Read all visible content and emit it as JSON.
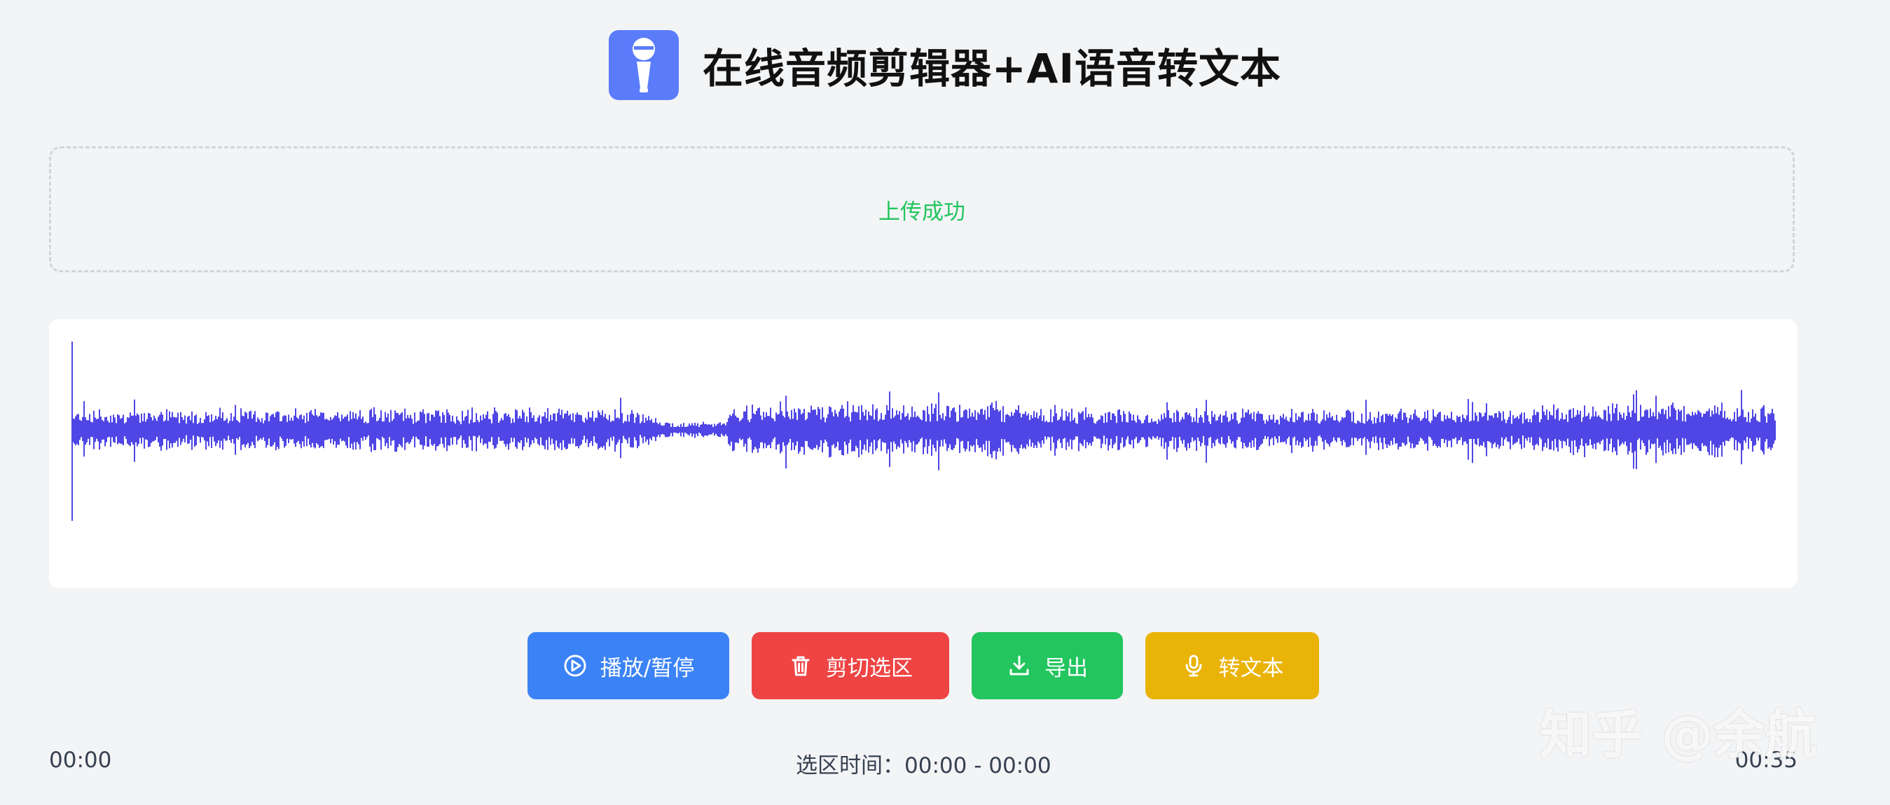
{
  "header": {
    "title": "在线音频剪辑器+AI语音转文本",
    "logo_icon": "microphone-icon",
    "logo_color": "#5b7cfa"
  },
  "upload": {
    "status_text": "上传成功",
    "status_color": "#22c55e"
  },
  "waveform": {
    "color": "#4f46e5"
  },
  "controls": {
    "play_label": "播放/暂停",
    "play_icon": "play-circle-icon",
    "play_color": "#3b82f6",
    "cut_label": "剪切选区",
    "cut_icon": "trash-icon",
    "cut_color": "#ef4444",
    "export_label": "导出",
    "export_icon": "download-icon",
    "export_color": "#22c55e",
    "transcribe_label": "转文本",
    "transcribe_icon": "microphone-icon",
    "transcribe_color": "#eab308"
  },
  "timeline": {
    "start_time": "00:00",
    "end_time": "00:35",
    "selection_text": "选区时间：00:00 - 00:00"
  },
  "watermark": {
    "text": "知乎 @余航"
  }
}
